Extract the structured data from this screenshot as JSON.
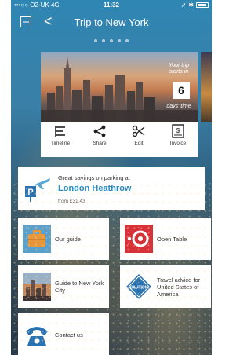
{
  "status": {
    "carrier": "•••○○ O2-UK  4G",
    "time": "11:32"
  },
  "nav": {
    "title": "Trip to New York",
    "back_glyph": "<"
  },
  "trip": {
    "countdown_top": "Your trip starts in",
    "countdown_value": "6",
    "countdown_unit": "days' time",
    "actions": [
      {
        "label": "Timeline"
      },
      {
        "label": "Share"
      },
      {
        "label": "Edit"
      },
      {
        "label": "Invoice"
      }
    ]
  },
  "parking": {
    "subtitle": "Great savings on parking at",
    "location": "London Heathrow",
    "price": "from £31.43"
  },
  "tiles": {
    "our_guide": "Our guide",
    "open_table": "Open Table",
    "nyc_guide": "Guide to New York City",
    "travel_advice": "Travel advice for United States of America",
    "contact_us": "Contact us",
    "caution_badge": "CAUTION"
  },
  "colors": {
    "accent_blue": "#2a8ac2",
    "guide_orange": "#e8963a",
    "opentable_red": "#d7323a",
    "caution_blue": "#2b72b0"
  }
}
